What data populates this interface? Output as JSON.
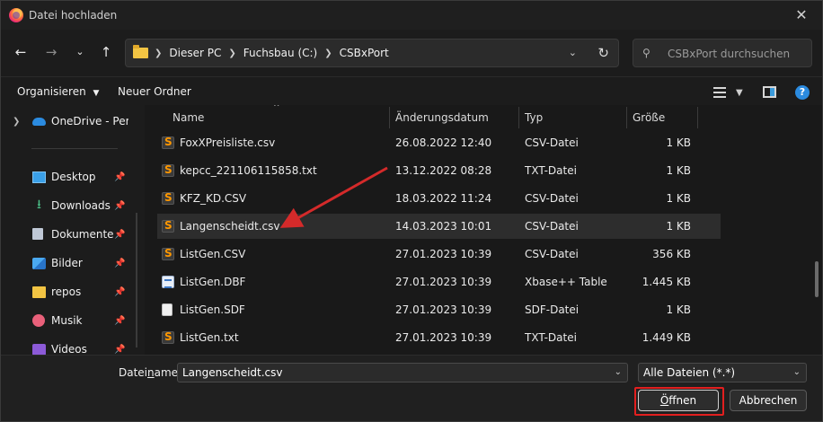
{
  "window": {
    "title": "Datei hochladen"
  },
  "address": {
    "crumbs": [
      "Dieser PC",
      "Fuchsbau (C:)",
      "CSBxPort"
    ]
  },
  "search": {
    "placeholder": "CSBxPort durchsuchen"
  },
  "toolbar": {
    "organize_label": "Organisieren",
    "new_folder_label": "Neuer Ordner"
  },
  "navpane": {
    "items": [
      {
        "label": "OneDrive - Perso",
        "icon": "cloud-icon",
        "pinned": false
      },
      {
        "label": "Desktop",
        "icon": "desktop-icon",
        "pinned": true
      },
      {
        "label": "Downloads",
        "icon": "download-icon",
        "pinned": true
      },
      {
        "label": "Dokumente",
        "icon": "document-icon",
        "pinned": true
      },
      {
        "label": "Bilder",
        "icon": "pictures-icon",
        "pinned": true
      },
      {
        "label": "repos",
        "icon": "folder-icon",
        "pinned": true
      },
      {
        "label": "Musik",
        "icon": "music-icon",
        "pinned": true
      },
      {
        "label": "Videos",
        "icon": "video-icon",
        "pinned": true
      }
    ]
  },
  "filelist": {
    "columns": {
      "name": "Name",
      "date": "Änderungsdatum",
      "type": "Typ",
      "size": "Größe"
    },
    "rows": [
      {
        "name": "FoxXPreisliste.csv",
        "date": "26.08.2022 12:40",
        "type": "CSV-Datei",
        "size": "1 KB",
        "icon": "sublime-file-icon"
      },
      {
        "name": "kepcc_221106115858.txt",
        "date": "13.12.2022 08:28",
        "type": "TXT-Datei",
        "size": "1 KB",
        "icon": "sublime-file-icon"
      },
      {
        "name": "KFZ_KD.CSV",
        "date": "18.03.2022 11:24",
        "type": "CSV-Datei",
        "size": "1 KB",
        "icon": "sublime-file-icon"
      },
      {
        "name": "Langenscheidt.csv",
        "date": "14.03.2023 10:01",
        "type": "CSV-Datei",
        "size": "1 KB",
        "icon": "sublime-file-icon",
        "selected": true
      },
      {
        "name": "ListGen.CSV",
        "date": "27.01.2023 10:39",
        "type": "CSV-Datei",
        "size": "356 KB",
        "icon": "sublime-file-icon"
      },
      {
        "name": "ListGen.DBF",
        "date": "27.01.2023 10:39",
        "type": "Xbase++ Table",
        "size": "1.445 KB",
        "icon": "table-file-icon"
      },
      {
        "name": "ListGen.SDF",
        "date": "27.01.2023 10:39",
        "type": "SDF-Datei",
        "size": "1 KB",
        "icon": "generic-file-icon"
      },
      {
        "name": "ListGen.txt",
        "date": "27.01.2023 10:39",
        "type": "TXT-Datei",
        "size": "1.449 KB",
        "icon": "sublime-file-icon"
      }
    ]
  },
  "bottom": {
    "filename_label_pre": "Datei",
    "filename_label_accel": "n",
    "filename_label_post": "ame:",
    "filename_value": "Langenscheidt.csv",
    "filter_value": "Alle Dateien (*.*)",
    "open_label_accel": "Ö",
    "open_label_rest": "ffnen",
    "cancel_label": "Abbrechen"
  },
  "colors": {
    "accent_blue": "#2b8be0",
    "highlight_red": "#e21f1f",
    "sublime_orange": "#ff9800"
  }
}
